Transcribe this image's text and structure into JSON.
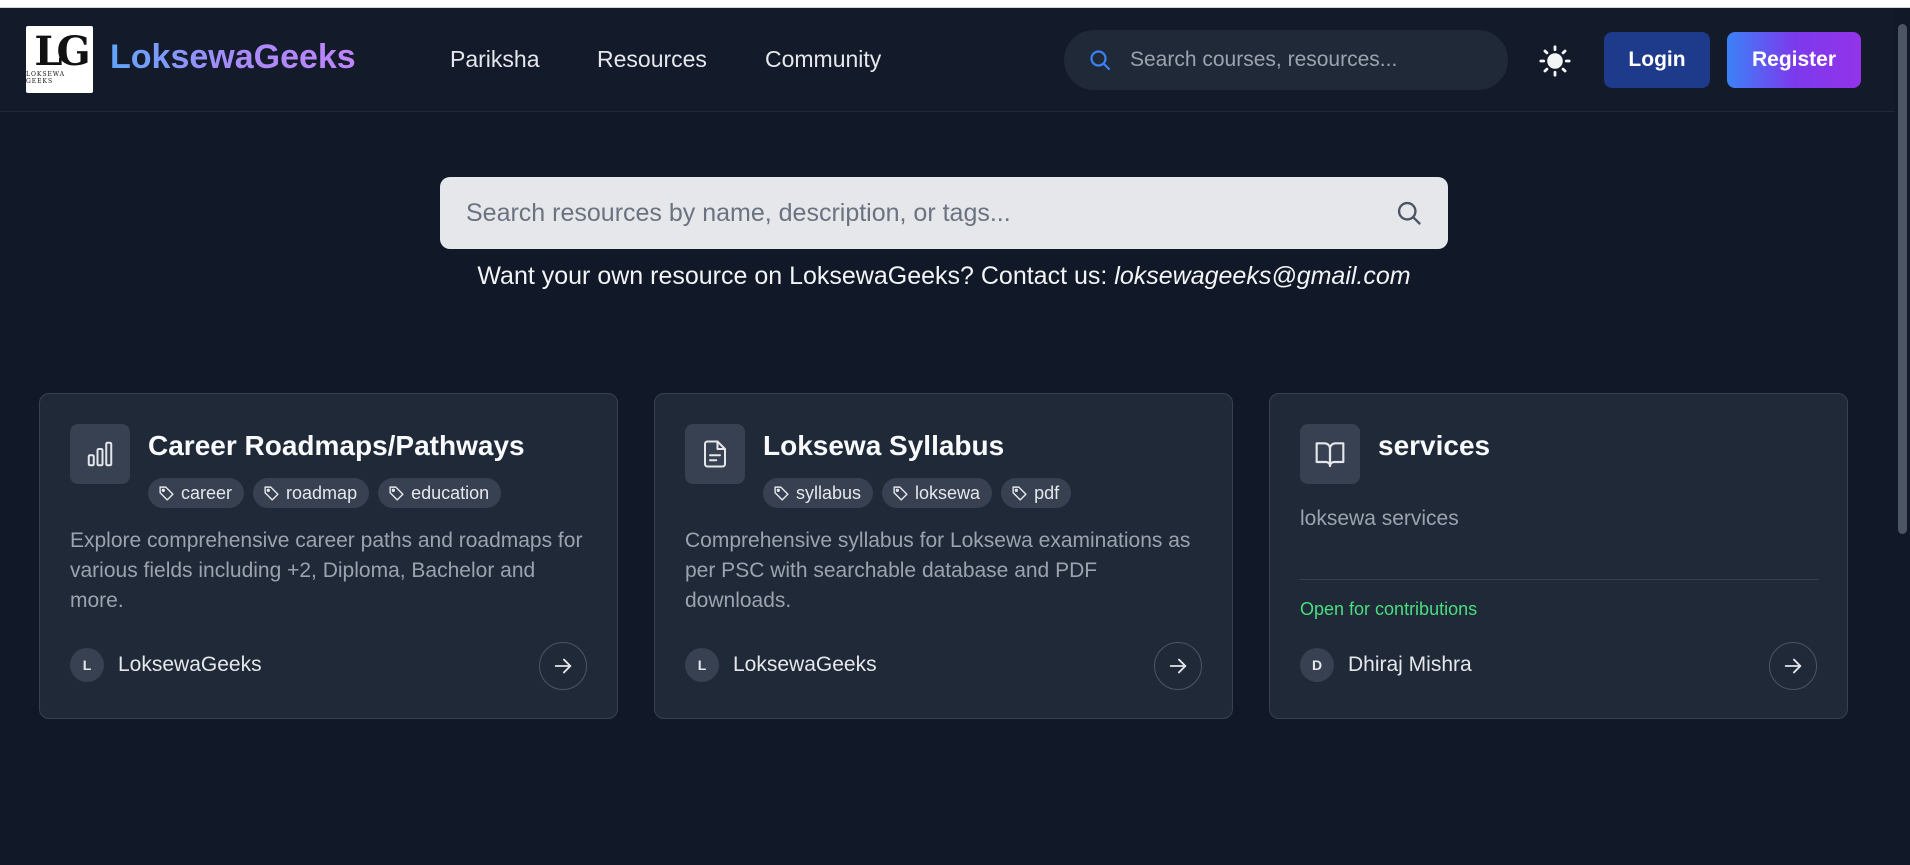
{
  "header": {
    "logo": {
      "letters": "LG",
      "small_text": "LOKSEWA GEEKS"
    },
    "brand": "LoksewaGeeks",
    "nav": [
      "Pariksha",
      "Resources",
      "Community"
    ],
    "search_placeholder": "Search courses, resources...",
    "theme_icon": "sun-icon",
    "login_label": "Login",
    "register_label": "Register"
  },
  "main_search": {
    "placeholder": "Search resources by name, description, or tags...",
    "icon": "search-icon"
  },
  "contact": {
    "text": "Want your own resource on LoksewaGeeks? Contact us:",
    "email": "loksewageeks@gmail.com"
  },
  "cards": [
    {
      "icon": "bar-chart-icon",
      "title": "Career Roadmaps/Pathways",
      "tags": [
        "career",
        "roadmap",
        "education"
      ],
      "description": "Explore comprehensive career paths and roadmaps for various fields including +2, Diploma, Bachelor and more.",
      "author_initial": "L",
      "author": "LoksewaGeeks"
    },
    {
      "icon": "file-text-icon",
      "title": "Loksewa Syllabus",
      "tags": [
        "syllabus",
        "loksewa",
        "pdf"
      ],
      "description": "Comprehensive syllabus for Loksewa examinations as per PSC with searchable database and PDF downloads.",
      "author_initial": "L",
      "author": "LoksewaGeeks"
    },
    {
      "icon": "book-open-icon",
      "title": "services",
      "tags": [],
      "description": "loksewa services",
      "contribution_status": "Open for contributions",
      "author_initial": "D",
      "author": "Dhiraj Mishra"
    }
  ],
  "colors": {
    "background": "#111827",
    "card": "#1f2937",
    "accent_blue": "#3b82f6",
    "accent_purple": "#9333ea",
    "contribution_green": "#4ade80"
  }
}
